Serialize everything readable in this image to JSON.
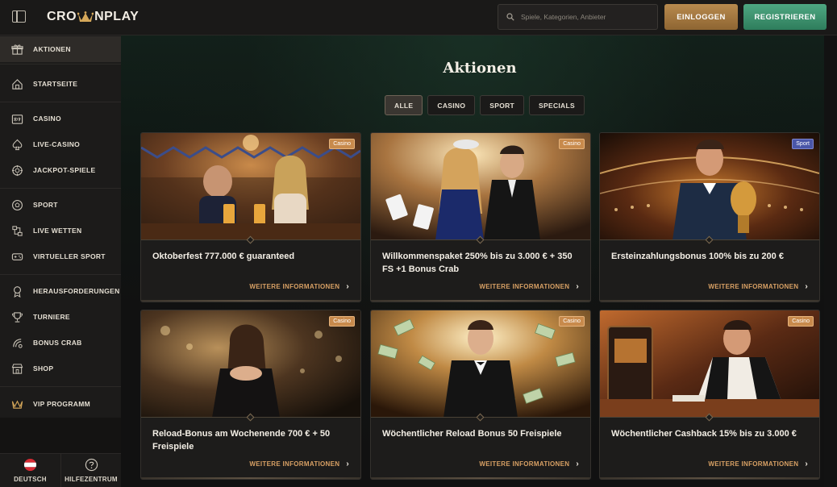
{
  "brand": {
    "name_left": "CRO",
    "name_right": "NPLAY",
    "accent": "#d6a85a"
  },
  "header": {
    "search_placeholder": "Spiele, Kategorien, Anbieter",
    "login_label": "EINLOGGEN",
    "register_label": "REGISTRIEREN"
  },
  "sidebar": {
    "items": [
      {
        "label": "AKTIONEN",
        "icon": "gift-icon",
        "active": true
      },
      {
        "label": "STARTSEITE",
        "icon": "home-icon"
      },
      {
        "label": "CASINO",
        "icon": "slot-machine-icon"
      },
      {
        "label": "LIVE-CASINO",
        "icon": "spade-icon"
      },
      {
        "label": "JACKPOT-SPIELE",
        "icon": "chip-icon"
      },
      {
        "label": "SPORT",
        "icon": "football-icon"
      },
      {
        "label": "LIVE WETTEN",
        "icon": "live-bet-icon"
      },
      {
        "label": "VIRTUELLER SPORT",
        "icon": "gamepad-icon"
      },
      {
        "label": "HERAUSFORDERUNGEN",
        "icon": "medal-icon"
      },
      {
        "label": "TURNIERE",
        "icon": "trophy-icon"
      },
      {
        "label": "BONUS CRAB",
        "icon": "crab-icon"
      },
      {
        "label": "SHOP",
        "icon": "shop-icon"
      },
      {
        "label": "VIP PROGRAMM",
        "icon": "crown-icon"
      }
    ],
    "language_label": "DEUTSCH",
    "help_label": "HILFEZENTRUM"
  },
  "main": {
    "title": "Aktionen",
    "filters": [
      "ALLE",
      "CASINO",
      "SPORT",
      "SPECIALS"
    ],
    "active_filter": "ALLE",
    "more_label": "WEITERE INFORMATIONEN",
    "cards": [
      {
        "title": "Oktoberfest 777.000 € guaranteed",
        "badge": "Casino"
      },
      {
        "title": "Willkommenspaket 250% bis zu 3.000 € + 350 FS +1 Bonus Crab",
        "badge": "Casino"
      },
      {
        "title": "Ersteinzahlungsbonus 100% bis zu 200 €",
        "badge": "Sport"
      },
      {
        "title": "Reload-Bonus am Wochenende 700 € + 50 Freispiele",
        "badge": "Casino"
      },
      {
        "title": "Wöchentlicher Reload Bonus 50 Freispiele",
        "badge": "Casino"
      },
      {
        "title": "Wöchentlicher Cashback 15% bis zu 3.000 €",
        "badge": "Casino"
      }
    ]
  },
  "colors": {
    "casino_badge": "#c88a4c",
    "sport_badge": "#4a56a8",
    "login_button": "#a87a40",
    "register_button": "#3f9470",
    "link": "#d8a064"
  }
}
